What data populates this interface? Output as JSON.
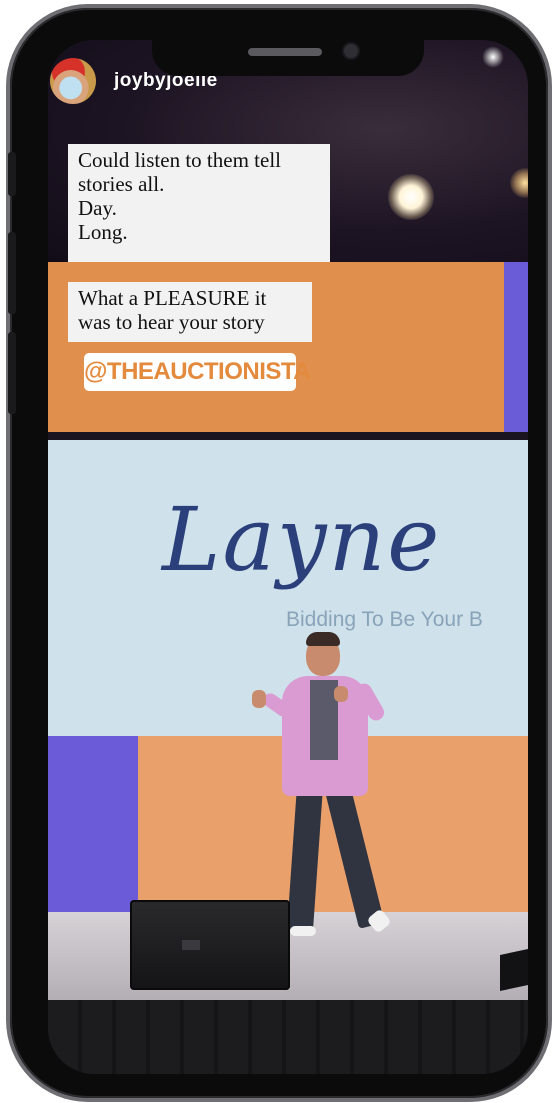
{
  "story": {
    "username": "joybyjoelle",
    "caption_1": "Could listen to them tell\nstories all.\nDay.\nLong.",
    "caption_2": "What a PLEASURE it\nwas to hear your story",
    "mention": "@THEAUCTIONISTA"
  },
  "screen_display": {
    "logo_text": "Layne",
    "tagline": "Bidding To Be Your B"
  },
  "colors": {
    "orange_panel": "#e08f4d",
    "purple_panel": "#6a5bd6",
    "blue_panel": "#cfe2ec",
    "mention_text": "#e48a3d"
  },
  "icons": {
    "avatar": "profile-avatar",
    "front_camera": "camera-dot",
    "earpiece": "speaker-slot"
  }
}
